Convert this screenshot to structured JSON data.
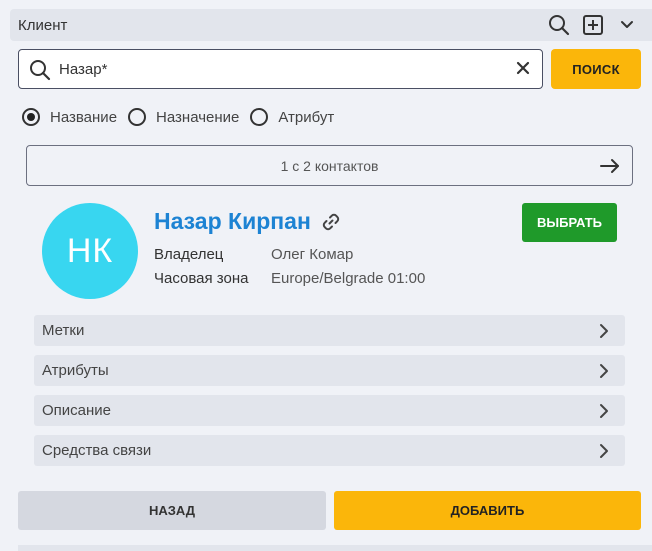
{
  "header": {
    "title": "Клиент",
    "icons": [
      "search-icon",
      "add-box-icon",
      "chevron-down-icon"
    ]
  },
  "search": {
    "value": "Назар*",
    "placeholder": "",
    "button_label": "ПОИСК"
  },
  "filters": {
    "options": [
      {
        "label": "Название",
        "selected": true
      },
      {
        "label": "Назначение",
        "selected": false
      },
      {
        "label": "Атрибут",
        "selected": false
      }
    ]
  },
  "pager": {
    "text": "1 с 2 контактов"
  },
  "contact": {
    "initials": "НК",
    "avatar_color": "#38d6f0",
    "name": "Назар Кирпан",
    "select_label": "ВЫБРАТЬ",
    "fields": [
      {
        "key": "Владелец",
        "value": "Олег Комар"
      },
      {
        "key": "Часовая зона",
        "value": "Europe/Belgrade 01:00"
      }
    ]
  },
  "sections": [
    "Метки",
    "Атрибуты",
    "Описание",
    "Средства связи"
  ],
  "footer": {
    "back_label": "НАЗАД",
    "add_label": "ДОБАВИТЬ"
  },
  "colors": {
    "accent": "#fbb60a",
    "success": "#1f9a2a",
    "link": "#1d83d3"
  }
}
